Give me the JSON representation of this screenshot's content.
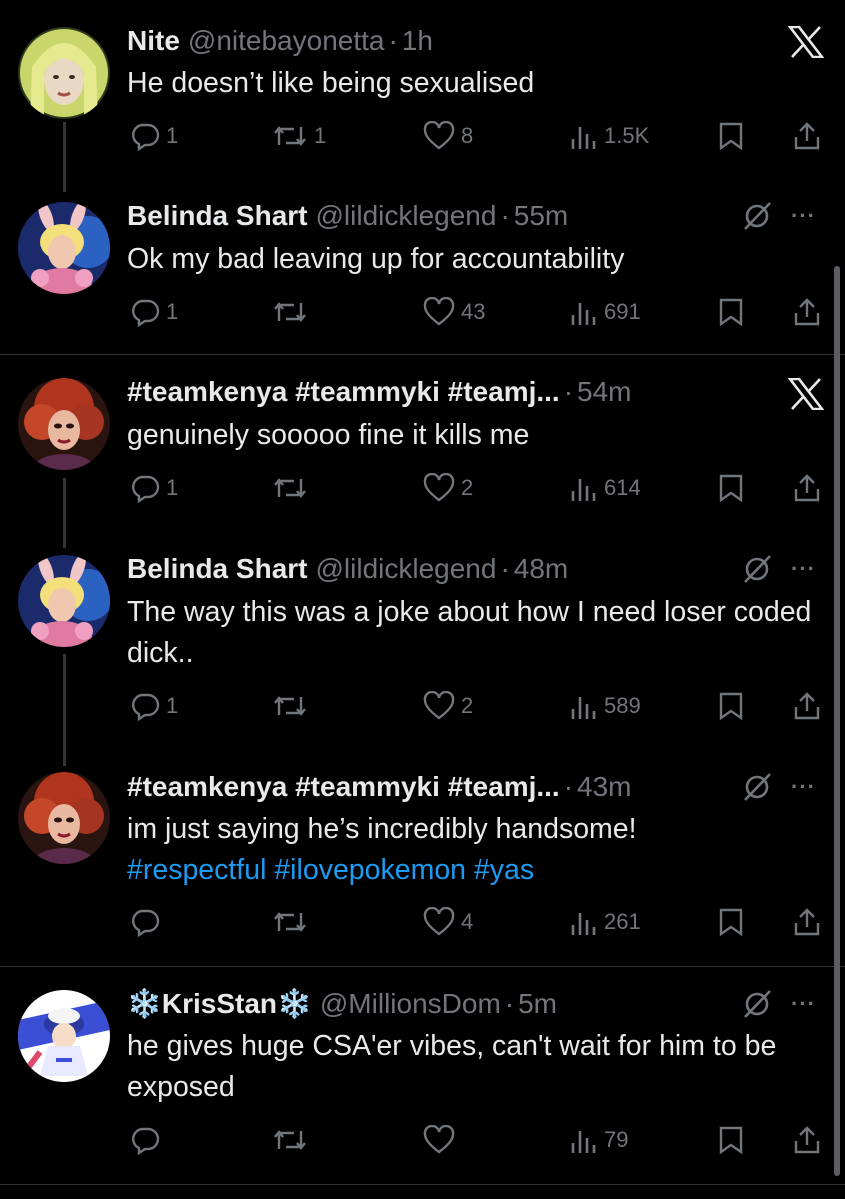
{
  "tweets": [
    {
      "name": "Nite",
      "handle": "@nitebayonetta",
      "time": "1h",
      "text": "He doesn’t like being sexualised",
      "replies": "1",
      "retweets": "1",
      "likes": "8",
      "views": "1.5K",
      "corner_icon": "x-logo-icon"
    },
    {
      "name": "Belinda Shart",
      "handle": "@lildicklegend",
      "time": "55m",
      "text": "Ok my bad leaving up for accountability",
      "replies": "1",
      "retweets": "",
      "likes": "43",
      "views": "691",
      "corner_icon": "grok-icon"
    },
    {
      "name": "#teamkenya #teammyki #teamj...",
      "handle": "",
      "time": "54m",
      "text": "genuinely sooooo fine it kills me",
      "replies": "1",
      "retweets": "",
      "likes": "2",
      "views": "614",
      "corner_icon": "x-logo-icon"
    },
    {
      "name": "Belinda Shart",
      "handle": "@lildicklegend",
      "time": "48m",
      "text": "The way this was a joke about how I need loser coded dick..",
      "replies": "1",
      "retweets": "",
      "likes": "2",
      "views": "589",
      "corner_icon": "grok-icon"
    },
    {
      "name": "#teamkenya #teammyki #teamj...",
      "handle": "",
      "time": "43m",
      "text": "im just saying he’s incredibly handsome!",
      "hashtags": "#respectful #ilovepokemon #yas",
      "replies": "",
      "retweets": "",
      "likes": "4",
      "views": "261",
      "corner_icon": "grok-icon"
    },
    {
      "name": "❄️KrisStan❄️",
      "handle": "@MillionsDom",
      "time": "5m",
      "text": "he gives huge CSA'er vibes, can't wait for him to be exposed",
      "replies": "",
      "retweets": "",
      "likes": "",
      "views": "79",
      "corner_icon": "grok-icon"
    }
  ],
  "separator": "·",
  "more_label": "···",
  "colors": {
    "background": "#000000",
    "text": "#e7e9ea",
    "muted": "#71767b",
    "link": "#1d9bf0"
  }
}
